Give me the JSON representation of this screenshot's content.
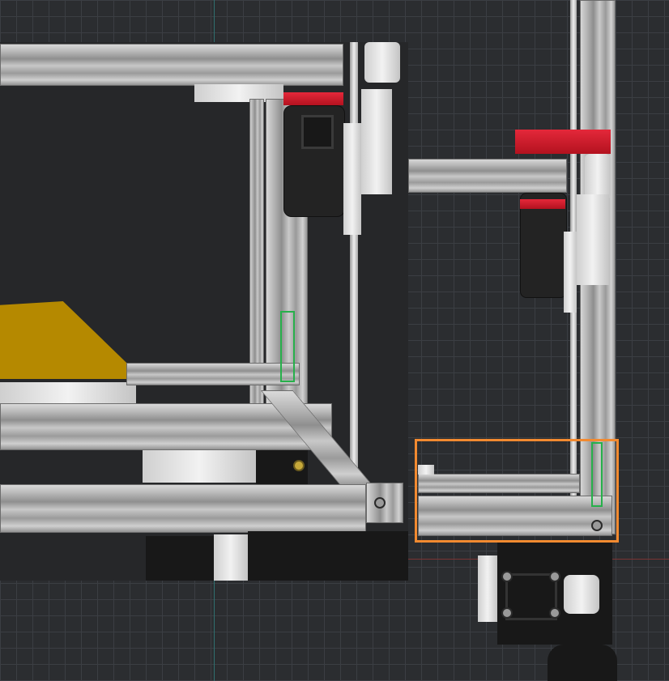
{
  "viewport": {
    "background": "#2b2d30",
    "grid_color": "#3b3e43",
    "x_axis_color": "#7a3434",
    "y_axis_color": "#2f6f6f"
  },
  "model": {
    "frame_color": "#bdbdbd",
    "accent_red": "#d61e2e",
    "bed_color": "#b58900",
    "selection_color": "#f28a30",
    "highlight_color": "#27b04b"
  }
}
